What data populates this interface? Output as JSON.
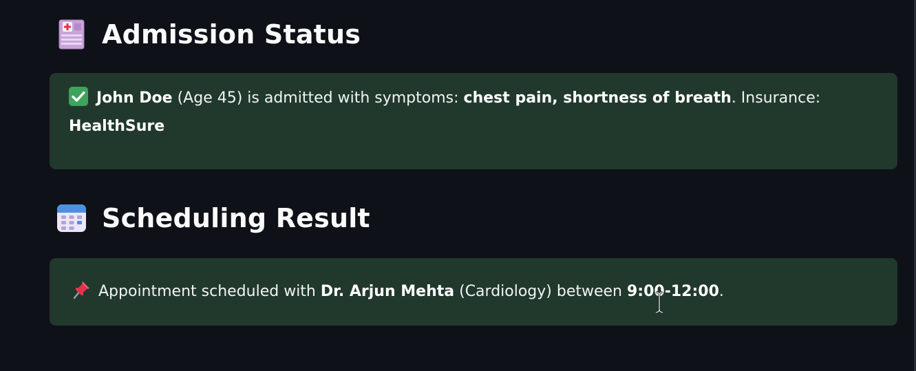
{
  "admission": {
    "heading": "Admission Status",
    "heading_icon": "hospital-icon",
    "status_icon": "check-mark-icon",
    "patient_name": "John Doe",
    "age_text": "(Age 45)",
    "mid_text": "is admitted with symptoms:",
    "symptoms": "chest pain, shortness of breath",
    "insurance_label": ". Insurance:",
    "insurance": "HealthSure",
    "colors": {
      "alert_background": "#21392c",
      "check_background": "#3da35d"
    }
  },
  "scheduling": {
    "heading": "Scheduling Result",
    "heading_icon": "calendar-icon",
    "status_icon": "pushpin-icon",
    "prefix_text": "Appointment scheduled with",
    "doctor": "Dr. Arjun Mehta",
    "department_text": "(Cardiology) between",
    "time_range": "9:00-12:00",
    "suffix": "."
  },
  "theme": {
    "page_background": "#0e1117",
    "text_color": "#fafafa"
  }
}
